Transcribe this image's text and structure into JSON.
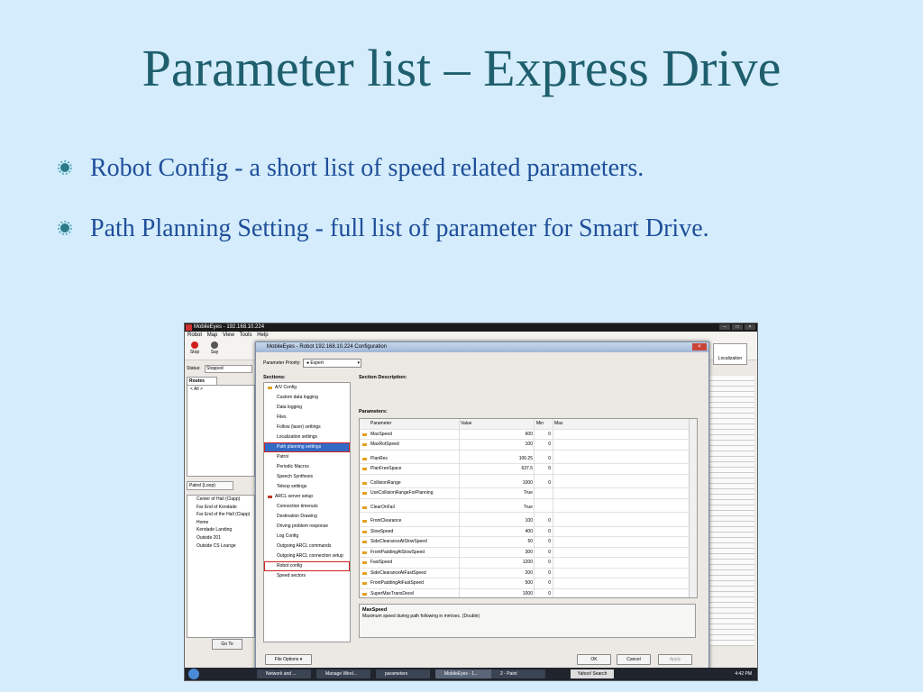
{
  "slide": {
    "title": "Parameter list – Express Drive",
    "bullets": [
      "Robot Config - a short list of speed related parameters.",
      "Path Planning Setting - full list of parameter for  Smart Drive."
    ]
  },
  "app": {
    "window_title": "MobileEyes - 192.168.10.224",
    "menu": [
      "Robot",
      "Map",
      "View",
      "Tools",
      "Help"
    ],
    "toolbar": {
      "stop": "Stop",
      "say": "Say",
      "localization": "Localization"
    },
    "status_label": "Status:",
    "status_value": "Stopped",
    "routes_tab": "Routes",
    "routes_item": "< All >",
    "patrol": "Patrol (Loop)",
    "goals": [
      "Center of Hall (Clapp)",
      "Far End of Kendade",
      "Far End of the Hall (Clapp)",
      "Home",
      "Kendade Landing",
      "Outside 201",
      "Outside CS Lounge"
    ],
    "goto": "Go To"
  },
  "dialog": {
    "title": "MobileEyes - Robot 192.168.10.224 Configuration",
    "priority_label": "Parameter Priority:",
    "priority_value": "Expert",
    "sections_label": "Sections:",
    "desc_label": "Section Description:",
    "params_label": "Parameters:",
    "sections": [
      {
        "label": "A/V Config",
        "type": "group"
      },
      {
        "label": "Custom data logging"
      },
      {
        "label": "Data logging"
      },
      {
        "label": "Files"
      },
      {
        "label": "Follow (laser) settings"
      },
      {
        "label": "Localization settings"
      },
      {
        "label": "Path planning settings",
        "selected": true,
        "highlight": true
      },
      {
        "label": "Patrol"
      },
      {
        "label": "Periodic Macros"
      },
      {
        "label": "Speech Synthesis"
      },
      {
        "label": "Teleop settings"
      },
      {
        "label": "ARCL server setup",
        "type": "open"
      },
      {
        "label": "Connection timeouts"
      },
      {
        "label": "Destination Drawing"
      },
      {
        "label": "Driving problem response"
      },
      {
        "label": "Log Config"
      },
      {
        "label": "Outgoing ARCL commands"
      },
      {
        "label": "Outgoing ARCL connection setup"
      },
      {
        "label": "Robot config",
        "highlight": true
      },
      {
        "label": "Speed sectors"
      }
    ],
    "table_headers": {
      "parameter": "Parameter",
      "value": "Value",
      "min": "Min",
      "max": "Max"
    },
    "params": [
      {
        "name": "MaxSpeed",
        "value": "600",
        "min": "0",
        "max": ""
      },
      {
        "name": "MaxRotSpeed",
        "value": "100",
        "min": "0",
        "max": ""
      },
      {
        "gap": true
      },
      {
        "name": "PlanRes",
        "value": "106.25",
        "min": "0",
        "max": ""
      },
      {
        "name": "PlanFreeSpace",
        "value": "637.5",
        "min": "0",
        "max": ""
      },
      {
        "gap": true
      },
      {
        "name": "CollisionRange",
        "value": "1000",
        "min": "0",
        "max": ""
      },
      {
        "name": "UseCollisionRangeForPlanning",
        "value": "True",
        "min": "",
        "max": ""
      },
      {
        "gap": true
      },
      {
        "name": "ClearOnFail",
        "value": "True",
        "min": "",
        "max": ""
      },
      {
        "gap": true
      },
      {
        "name": "FrontClearance",
        "value": "100",
        "min": "0",
        "max": ""
      },
      {
        "name": "SlowSpeed",
        "value": "400",
        "min": "0",
        "max": ""
      },
      {
        "name": "SideClearanceAtSlowSpeed",
        "value": "50",
        "min": "0",
        "max": ""
      },
      {
        "name": "FrontPaddingAtSlowSpeed",
        "value": "300",
        "min": "0",
        "max": ""
      },
      {
        "name": "FastSpeed",
        "value": "1200",
        "min": "0",
        "max": ""
      },
      {
        "name": "SideClearanceAtFastSpeed",
        "value": "200",
        "min": "0",
        "max": ""
      },
      {
        "name": "FrontPaddingAtFastSpeed",
        "value": "500",
        "min": "0",
        "max": ""
      },
      {
        "name": "SuperMaxTransDecel",
        "value": "1000",
        "min": "0",
        "max": ""
      }
    ],
    "description_title": "MaxSpeed",
    "description_text": "Maximum speed during path following in mm/sec. (Double)",
    "file_options": "File Options",
    "ok": "OK",
    "cancel": "Cancel",
    "apply": "Apply"
  },
  "taskbar": {
    "items": [
      "Network and ...",
      "Manage Wirel...",
      "parameters",
      "MobileEyes - 1...",
      "2 - Paint"
    ],
    "search": "Yahoo! Search",
    "clock": "4:42 PM"
  }
}
